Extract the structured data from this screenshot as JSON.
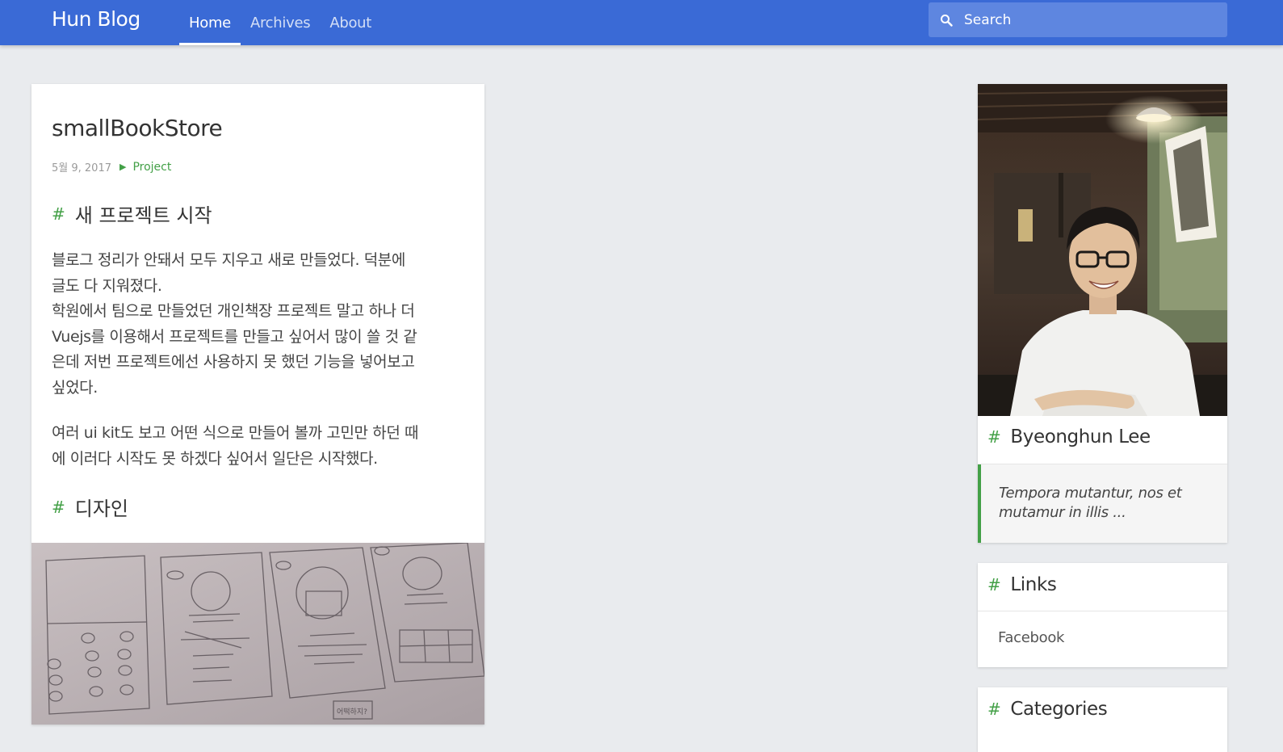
{
  "header": {
    "brand": "Hun Blog",
    "nav": [
      {
        "label": "Home",
        "active": true
      },
      {
        "label": "Archives",
        "active": false
      },
      {
        "label": "About",
        "active": false
      }
    ],
    "search": {
      "placeholder": "Search",
      "icon": "search-icon"
    }
  },
  "post": {
    "title": "smallBookStore",
    "date": "5월 9, 2017",
    "category": "Project",
    "sections": [
      {
        "heading": "새 프로젝트 시작",
        "paragraphs": [
          [
            "블로그 정리가 안돼서 모두 지우고 새로 만들었다. 덕분에",
            "글도 다 지워졌다.",
            "학원에서 팀으로 만들었던 개인책장 프로젝트 말고 하나 더",
            "Vuejs를 이용해서 프로젝트를 만들고 싶어서 많이 쓸 것 같",
            "은데 저번 프로젝트에선 사용하지 못 했던 기능을 넣어보고",
            "싶었다."
          ],
          [
            "여러 ui kit도 보고 어떤 식으로 만들어 볼까 고민만 하던 때",
            "에 이러다 시작도 못 하겠다 싶어서 일단은 시작했다."
          ]
        ]
      },
      {
        "heading": "디자인",
        "paragraphs": []
      }
    ],
    "sketch_note": "어떡하지?"
  },
  "sidebar": {
    "profile": {
      "name": "Byeonghun Lee",
      "quote_line1": "Tempora mutantur, nos et",
      "quote_line2": "mutamur in illis ..."
    },
    "links": {
      "title": "Links",
      "items": [
        "Facebook"
      ]
    },
    "categories": {
      "title": "Categories"
    }
  },
  "colors": {
    "header": "#3a6ad6",
    "accent": "#43a047",
    "background": "#e9ebee"
  }
}
